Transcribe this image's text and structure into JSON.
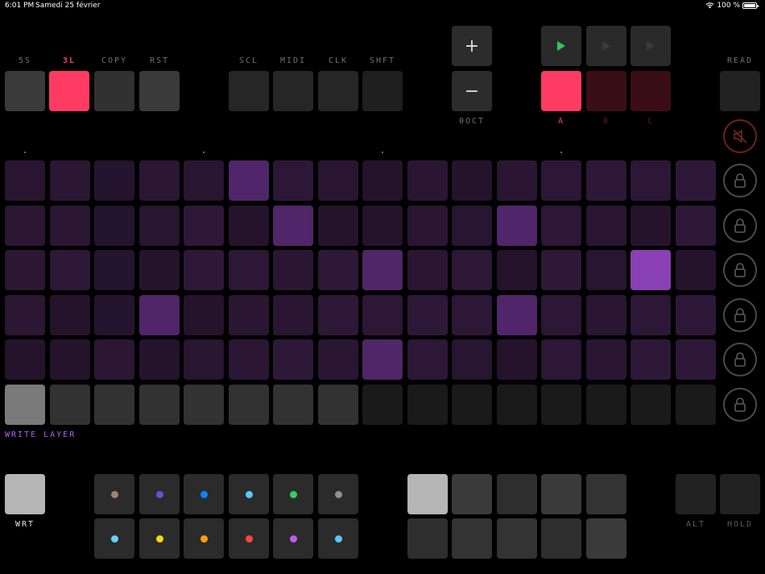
{
  "status_bar": {
    "time": "6:01 PM",
    "date": "Samedi 25 février",
    "battery": "100 %"
  },
  "top_labels": {
    "five_s": "5S",
    "three_l": "3L",
    "copy": "COPY",
    "rst": "RST",
    "scl": "SCL",
    "midi": "MIDI",
    "clk": "CLK",
    "shft": "SHFT",
    "read": "READ",
    "oct": "0OCT",
    "pattern_a": "A",
    "pattern_b": "B",
    "pattern_c": "C"
  },
  "octave": {
    "plus": "+",
    "minus": "−"
  },
  "write_layer_label": "WRITE LAYER",
  "bottom_labels": {
    "wrt": "WRT",
    "alt": "ALT",
    "hold": "HOLD"
  },
  "colors": {
    "accent_pink": "#ff3b63",
    "play_green": "#34c759",
    "write_layer_purple": "#b65ef0"
  },
  "icons": {
    "mute": "speaker-muted-icon",
    "lock": "lock-icon",
    "play": "play-icon"
  },
  "grid": {
    "rows": [
      [
        "#291530",
        "#2b1634",
        "#25142d",
        "#2b1634",
        "#281530",
        "#512569",
        "#2c1736",
        "#291532",
        "#25132c",
        "#2a1633",
        "#25132c",
        "#2a1633",
        "#2c1736",
        "#2e1838",
        "#2c1736",
        "#2e1838"
      ],
      [
        "#2b1634",
        "#2b1634",
        "#25142d",
        "#28152f",
        "#2e1838",
        "#25132c",
        "#512569",
        "#25132c",
        "#25132c",
        "#2a1633",
        "#28152f",
        "#512569",
        "#2c1736",
        "#2a1633",
        "#25132c",
        "#2e1838"
      ],
      [
        "#2b1634",
        "#2e1838",
        "#25142d",
        "#25132c",
        "#2e1838",
        "#2c1736",
        "#2a1633",
        "#2e1838",
        "#512569",
        "#2a1633",
        "#2c1736",
        "#25132c",
        "#2e1838",
        "#28152f",
        "#8a41b3",
        "#25132c"
      ],
      [
        "#2b1634",
        "#25132c",
        "#25142d",
        "#512569",
        "#25132c",
        "#2a1633",
        "#2a1633",
        "#2e1838",
        "#2c1736",
        "#2e1838",
        "#2c1736",
        "#512569",
        "#2c1736",
        "#2a1633",
        "#2c1736",
        "#2e1838"
      ],
      [
        "#25132c",
        "#25132c",
        "#2b1634",
        "#25132c",
        "#28152f",
        "#2b1634",
        "#2e1838",
        "#2a1633",
        "#512569",
        "#2c1736",
        "#28152f",
        "#25132c",
        "#2c1736",
        "#2a1633",
        "#2e1838",
        "#2e1838"
      ],
      [
        "#7a7a7a",
        "#323232",
        "#323232",
        "#323232",
        "#323232",
        "#323232",
        "#323232",
        "#323232",
        "#1a1a1a",
        "#1a1a1a",
        "#1a1a1a",
        "#1a1a1a",
        "#1a1a1a",
        "#1a1a1a",
        "#1a1a1a",
        "#1a1a1a"
      ]
    ]
  },
  "color_pads": {
    "row1": [
      "#a0826d",
      "#5856d6",
      "#0a84ff",
      "#5ac8fa",
      "#30d158",
      "#8e8e93"
    ],
    "row2": [
      "#64d2ff",
      "#ffd60a",
      "#ff9f0a",
      "#ff453a",
      "#bf5af2",
      "#5ac8fa"
    ]
  },
  "right_pads": {
    "row1": [
      "#b5b5b5",
      "#3a3a3a",
      "#2e2e2e",
      "#3a3a3a",
      "#333333"
    ],
    "row2": [
      "#2e2e2e",
      "#333333",
      "#333333",
      "#2e2e2e",
      "#3a3a3a"
    ]
  }
}
